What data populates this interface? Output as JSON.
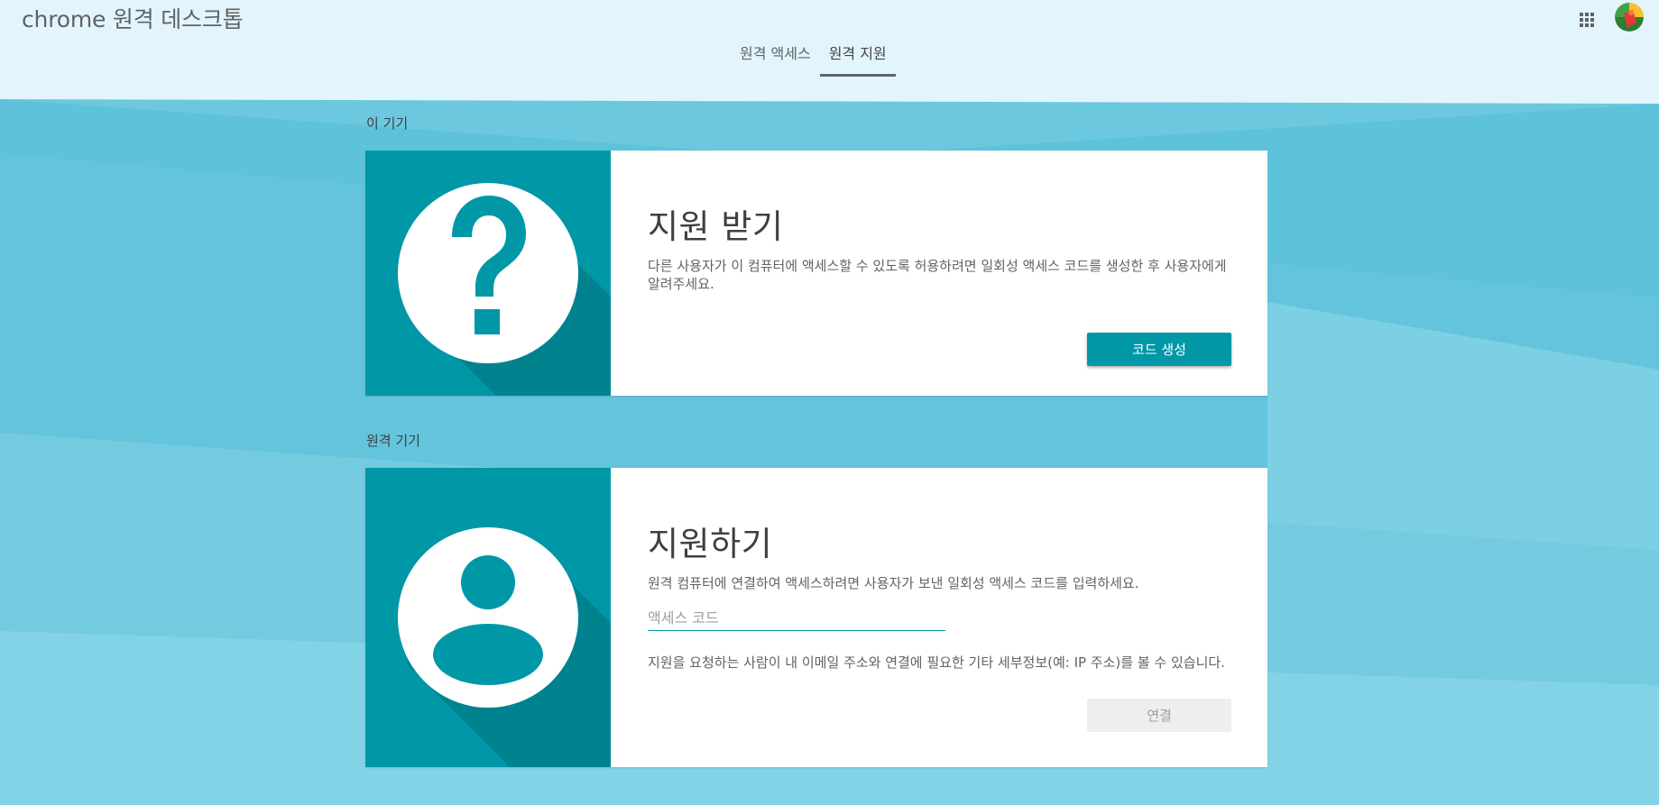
{
  "app": {
    "title": "chrome 원격 데스크톱"
  },
  "header": {
    "apps_icon": "apps-grid-icon",
    "avatar_icon": "user-avatar-icon"
  },
  "tabs": [
    {
      "label": "원격 액세스",
      "active": false
    },
    {
      "label": "원격 지원",
      "active": true
    }
  ],
  "this_device": {
    "section_label": "이 기기",
    "card": {
      "icon": "help-question-icon",
      "title": "지원 받기",
      "description": "다른 사용자가 이 컴퓨터에 액세스할 수 있도록 허용하려면 일회성 액세스 코드를 생성한 후 사용자에게 알려주세요.",
      "button_label": "코드 생성"
    }
  },
  "remote_device": {
    "section_label": "원격 기기",
    "card": {
      "icon": "person-icon",
      "title": "지원하기",
      "description": "원격 컴퓨터에 연결하여 액세스하려면 사용자가 보낸 일회성 액세스 코드를 입력하세요.",
      "input_value": "",
      "input_placeholder": "액세스 코드",
      "note": "지원을 요청하는 사람이 내 이메일 주소와 연결에 필요한 기타 세부정보(예: IP 주소)를 볼 수 있습니다.",
      "button_label": "연결",
      "button_disabled": true
    }
  },
  "colors": {
    "accent": "#0097a7",
    "accent_dark": "#00838f",
    "background_top": "#e3f5fc",
    "background_teal": "#6ccbdf"
  }
}
